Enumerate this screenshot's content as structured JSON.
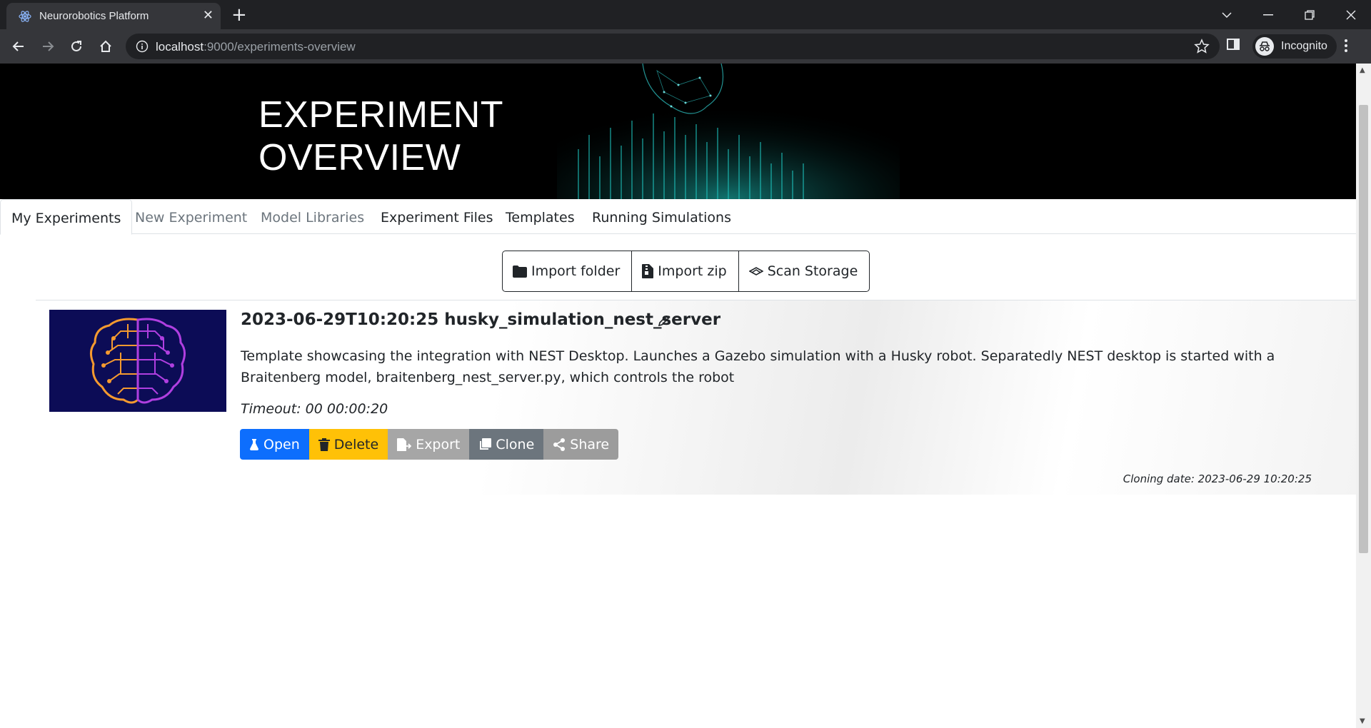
{
  "browser": {
    "tab_title": "Neurorobotics Platform",
    "url_host": "localhost",
    "url_path": ":9000/experiments-overview",
    "profile_label": "Incognito"
  },
  "banner": {
    "title_line1": "EXPERIMENT",
    "title_line2": "OVERVIEW"
  },
  "tabs": [
    {
      "label": "My Experiments"
    },
    {
      "label": "New Experiment"
    },
    {
      "label": "Model Libraries"
    },
    {
      "label": "Experiment Files"
    },
    {
      "label": "Templates"
    },
    {
      "label": "Running Simulations"
    }
  ],
  "toolbar": {
    "import_folder": "Import folder",
    "import_zip": "Import zip",
    "scan_storage": "Scan Storage"
  },
  "experiment": {
    "title": "2023-06-29T10:20:25 husky_simulation_nest_server",
    "description": "Template showcasing the integration with NEST Desktop. Launches a Gazebo simulation with a Husky robot. Separatedly NEST desktop is started with a Braitenberg model, braitenberg_nest_server.py, which controls the robot",
    "timeout": "Timeout: 00 00:00:20",
    "cloning_date": "Cloning date: 2023-06-29 10:20:25",
    "actions": {
      "open": "Open",
      "delete": "Delete",
      "export": "Export",
      "clone": "Clone",
      "share": "Share"
    }
  },
  "colors": {
    "primary": "#0d6efd",
    "warning": "#ffc107",
    "secondary": "#6c757d",
    "banner_accent": "#17b3b3"
  }
}
